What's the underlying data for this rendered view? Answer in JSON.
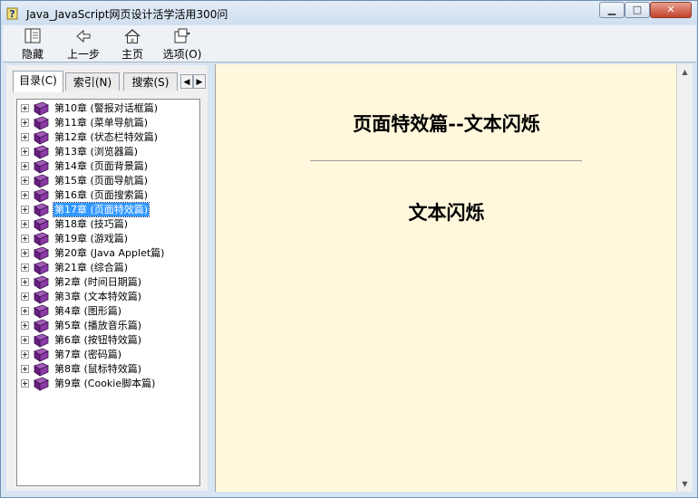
{
  "window": {
    "title": "Java_JavaScript网页设计活学活用300问",
    "controls": {
      "minimize": "▁",
      "maximize": "□",
      "close": "✕"
    }
  },
  "toolbar": {
    "hide_label": "隐藏",
    "back_label": "上一步",
    "home_label": "主页",
    "options_label": "选项(O)"
  },
  "tabs": [
    {
      "label": "目录(C)"
    },
    {
      "label": "索引(N)"
    },
    {
      "label": "搜索(S)"
    }
  ],
  "tree": {
    "items": [
      {
        "label": "第10章 (警报对话框篇)"
      },
      {
        "label": "第11章 (菜单导航篇)"
      },
      {
        "label": "第12章 (状态栏特效篇)"
      },
      {
        "label": "第13章 (浏览器篇)"
      },
      {
        "label": "第14章 (页面背景篇)"
      },
      {
        "label": "第15章 (页面导航篇)"
      },
      {
        "label": "第16章 (页面搜索篇)"
      },
      {
        "label": "第17章 (页面特效篇)"
      },
      {
        "label": "第18章 (技巧篇)"
      },
      {
        "label": "第19章 (游戏篇)"
      },
      {
        "label": "第20章 (Java Applet篇)"
      },
      {
        "label": "第21章 (综合篇)"
      },
      {
        "label": "第2章 (时间日期篇)"
      },
      {
        "label": "第3章 (文本特效篇)"
      },
      {
        "label": "第4章 (图形篇)"
      },
      {
        "label": "第5章 (播放音乐篇)"
      },
      {
        "label": "第6章 (按钮特效篇)"
      },
      {
        "label": "第7章 (密码篇)"
      },
      {
        "label": "第8章 (鼠标特效篇)"
      },
      {
        "label": "第9章 (Cookie脚本篇)"
      }
    ],
    "selected_index": 7
  },
  "content": {
    "heading": "页面特效篇--文本闪烁",
    "subheading": "文本闪烁"
  },
  "colors": {
    "content_background": "#fff8dc",
    "selection": "#3399ff",
    "book_icon": "#7b2d8e"
  },
  "icons": {
    "app": "help-question-icon",
    "hide": "hide-pane-icon",
    "back": "back-arrow-icon",
    "home": "home-icon",
    "options": "options-icon",
    "tree_item": "book-icon",
    "expander": "plus-expand-icon"
  }
}
